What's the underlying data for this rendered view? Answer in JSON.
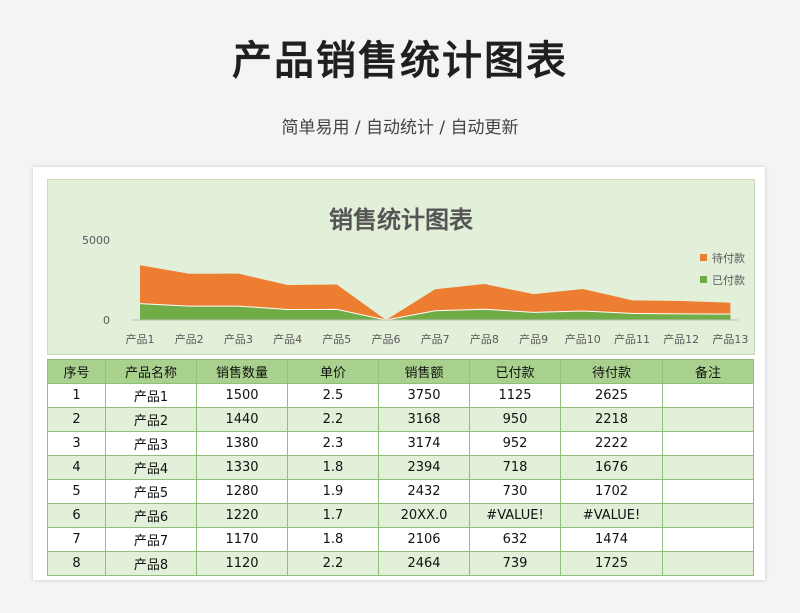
{
  "header": {
    "title": "产品销售统计图表",
    "subtitle": "简单易用 / 自动统计 / 自动更新"
  },
  "colors": {
    "unpaid": "#ed7d31",
    "paid": "#70ad47",
    "header_row": "#a9d18e",
    "band_row": "#e2efd9",
    "chart_bg": "#e2efd9"
  },
  "chart_data": {
    "type": "area",
    "title": "销售统计图表",
    "categories": [
      "产品1",
      "产品2",
      "产品3",
      "产品4",
      "产品5",
      "产品6",
      "产品7",
      "产品8",
      "产品9",
      "产品10",
      "产品11",
      "产品12",
      "产品13"
    ],
    "series": [
      {
        "name": "已付款",
        "values": [
          1125,
          950,
          952,
          718,
          730,
          0,
          632,
          739,
          520,
          620,
          450,
          420,
          400
        ]
      },
      {
        "name": "待付款",
        "values": [
          2625,
          2218,
          2222,
          1676,
          1702,
          0,
          1474,
          1725,
          1250,
          1500,
          900,
          880,
          780
        ]
      }
    ],
    "stacked": true,
    "y_ticks": [
      "5000",
      "0"
    ],
    "ylim": [
      0,
      5000
    ],
    "grid": false,
    "legend_position": "right"
  },
  "table": {
    "headers": [
      "序号",
      "产品名称",
      "销售数量",
      "单价",
      "销售额",
      "已付款",
      "待付款",
      "备注"
    ],
    "rows": [
      [
        "1",
        "产品1",
        "1500",
        "2.5",
        "3750",
        "1125",
        "2625",
        ""
      ],
      [
        "2",
        "产品2",
        "1440",
        "2.2",
        "3168",
        "950",
        "2218",
        ""
      ],
      [
        "3",
        "产品3",
        "1380",
        "2.3",
        "3174",
        "952",
        "2222",
        ""
      ],
      [
        "4",
        "产品4",
        "1330",
        "1.8",
        "2394",
        "718",
        "1676",
        ""
      ],
      [
        "5",
        "产品5",
        "1280",
        "1.9",
        "2432",
        "730",
        "1702",
        ""
      ],
      [
        "6",
        "产品6",
        "1220",
        "1.7",
        "20XX.0",
        "#VALUE!",
        "#VALUE!",
        ""
      ],
      [
        "7",
        "产品7",
        "1170",
        "1.8",
        "2106",
        "632",
        "1474",
        ""
      ],
      [
        "8",
        "产品8",
        "1120",
        "2.2",
        "2464",
        "739",
        "1725",
        ""
      ]
    ]
  }
}
